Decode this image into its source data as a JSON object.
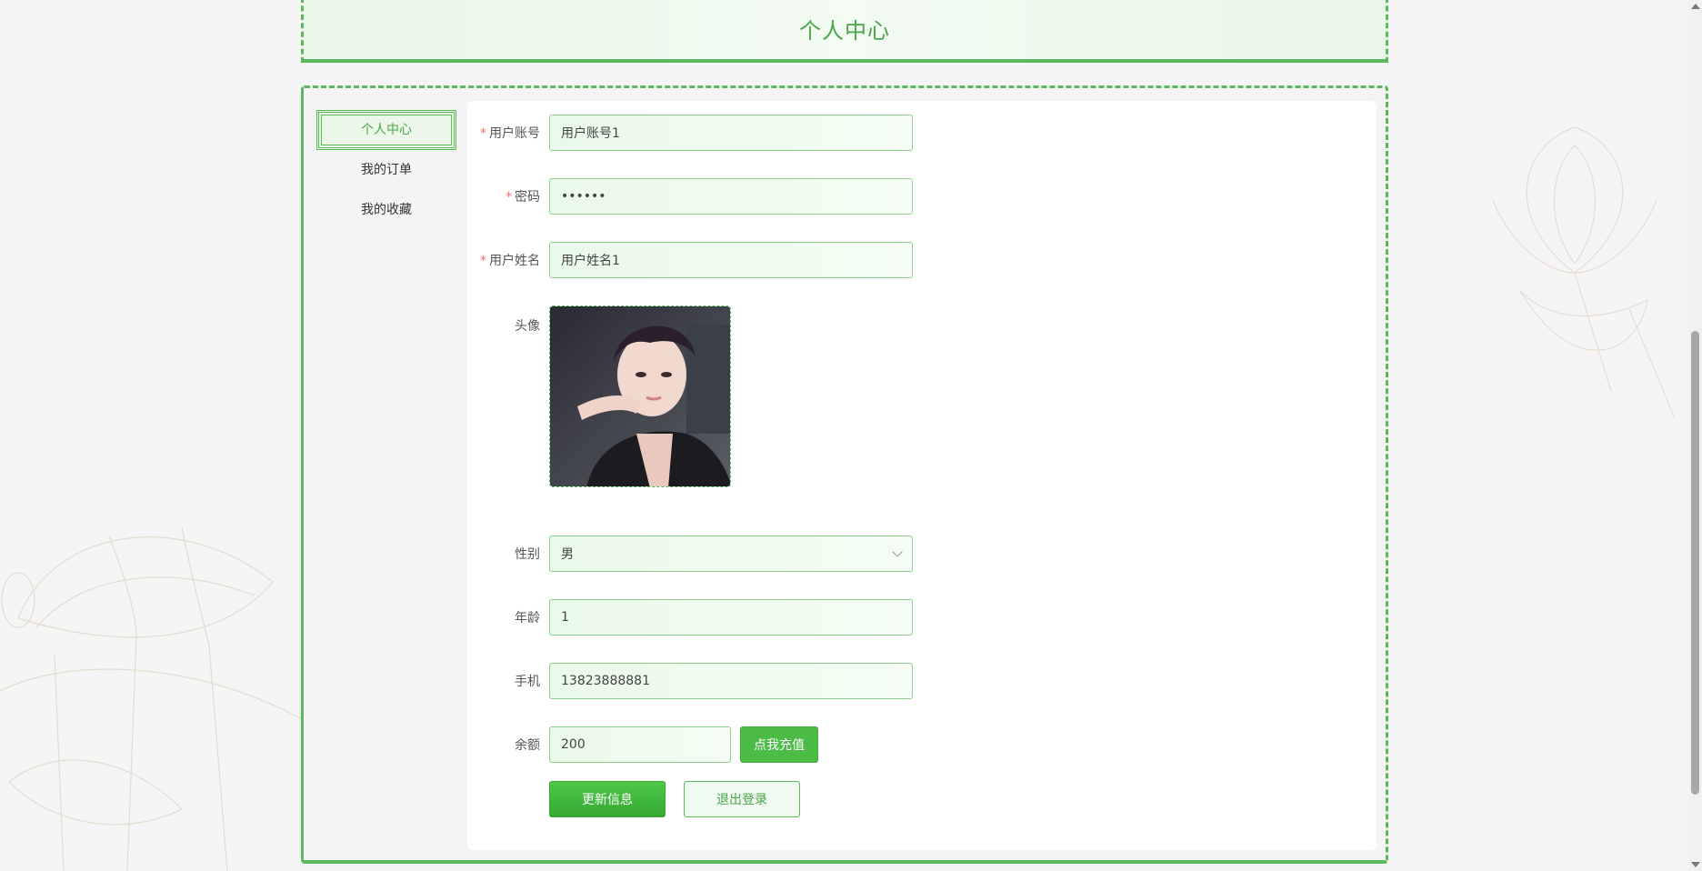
{
  "page": {
    "title": "个人中心"
  },
  "menu": {
    "items": [
      {
        "label": "个人中心",
        "active": true
      },
      {
        "label": "我的订单",
        "active": false
      },
      {
        "label": "我的收藏",
        "active": false
      }
    ]
  },
  "form": {
    "account": {
      "label": "用户账号",
      "required": "*",
      "value": "用户账号1"
    },
    "password": {
      "label": "密码",
      "required": "*",
      "value": "••••••"
    },
    "name": {
      "label": "用户姓名",
      "required": "*",
      "value": "用户姓名1"
    },
    "avatar": {
      "label": "头像"
    },
    "gender": {
      "label": "性别",
      "value": "男"
    },
    "age": {
      "label": "年龄",
      "value": "1"
    },
    "phone": {
      "label": "手机",
      "value": "13823888881"
    },
    "balance": {
      "label": "余额",
      "value": "200",
      "recharge_label": "点我充值"
    },
    "update_label": "更新信息",
    "logout_label": "退出登录"
  },
  "colors": {
    "accent": "#4cbc47",
    "border": "#5bb85b",
    "required": "#f56c6c"
  }
}
